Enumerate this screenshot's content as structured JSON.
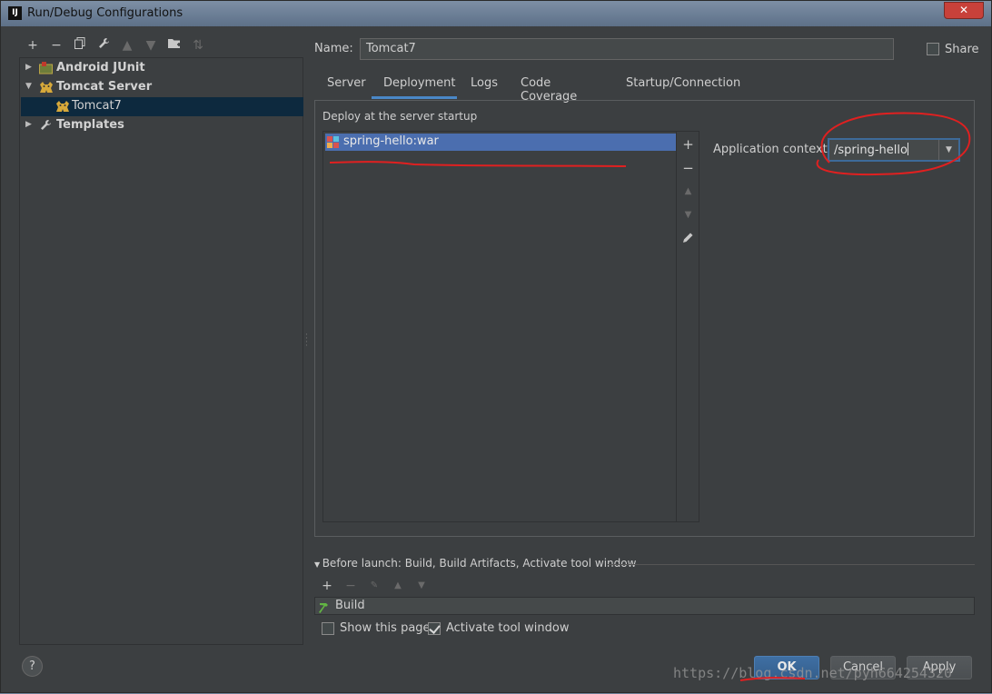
{
  "window": {
    "title": "Run/Debug Configurations",
    "app_icon": "IJ",
    "close_symbol": "✕"
  },
  "left_toolbar": [
    "add-icon",
    "remove-icon",
    "copy-icon",
    "wrench-icon",
    "move-up-icon",
    "move-down-icon",
    "folder-icon",
    "sort-icon"
  ],
  "tree": {
    "items": [
      {
        "label": "Android JUnit",
        "expanded": false,
        "icon": "android-junit-icon"
      },
      {
        "label": "Tomcat Server",
        "expanded": true,
        "icon": "tomcat-icon"
      },
      {
        "label": "Tomcat7",
        "selected": true,
        "icon": "tomcat-icon"
      },
      {
        "label": "Templates",
        "expanded": false,
        "icon": "wrench-icon"
      }
    ]
  },
  "config": {
    "name_label": "Name:",
    "name_value": "Tomcat7",
    "share_label": "Share",
    "share_checked": false
  },
  "tabs": [
    {
      "label": "Server",
      "active": false
    },
    {
      "label": "Deployment",
      "active": true
    },
    {
      "label": "Logs",
      "active": false
    },
    {
      "label": "Code Coverage",
      "active": false
    },
    {
      "label": "Startup/Connection",
      "active": false
    }
  ],
  "deployment": {
    "section_title": "Deploy at the server startup",
    "artifacts": [
      "spring-hello:war"
    ],
    "app_context_label": "Application context:",
    "app_context_value": "/spring-hello"
  },
  "before_launch": {
    "title": "Before launch: Build, Build Artifacts, Activate tool window",
    "tasks": [
      "Build"
    ],
    "show_page_label": "Show this page",
    "show_page_checked": false,
    "activate_label": "Activate tool window",
    "activate_checked": true
  },
  "buttons": {
    "help": "?",
    "ok": "OK",
    "cancel": "Cancel",
    "apply": "Apply"
  },
  "watermark": "https://blog.csdn.net/pyh664254320",
  "colors": {
    "accent": "#4b6eaf",
    "annotation": "#e02020",
    "background": "#3c3f41"
  }
}
